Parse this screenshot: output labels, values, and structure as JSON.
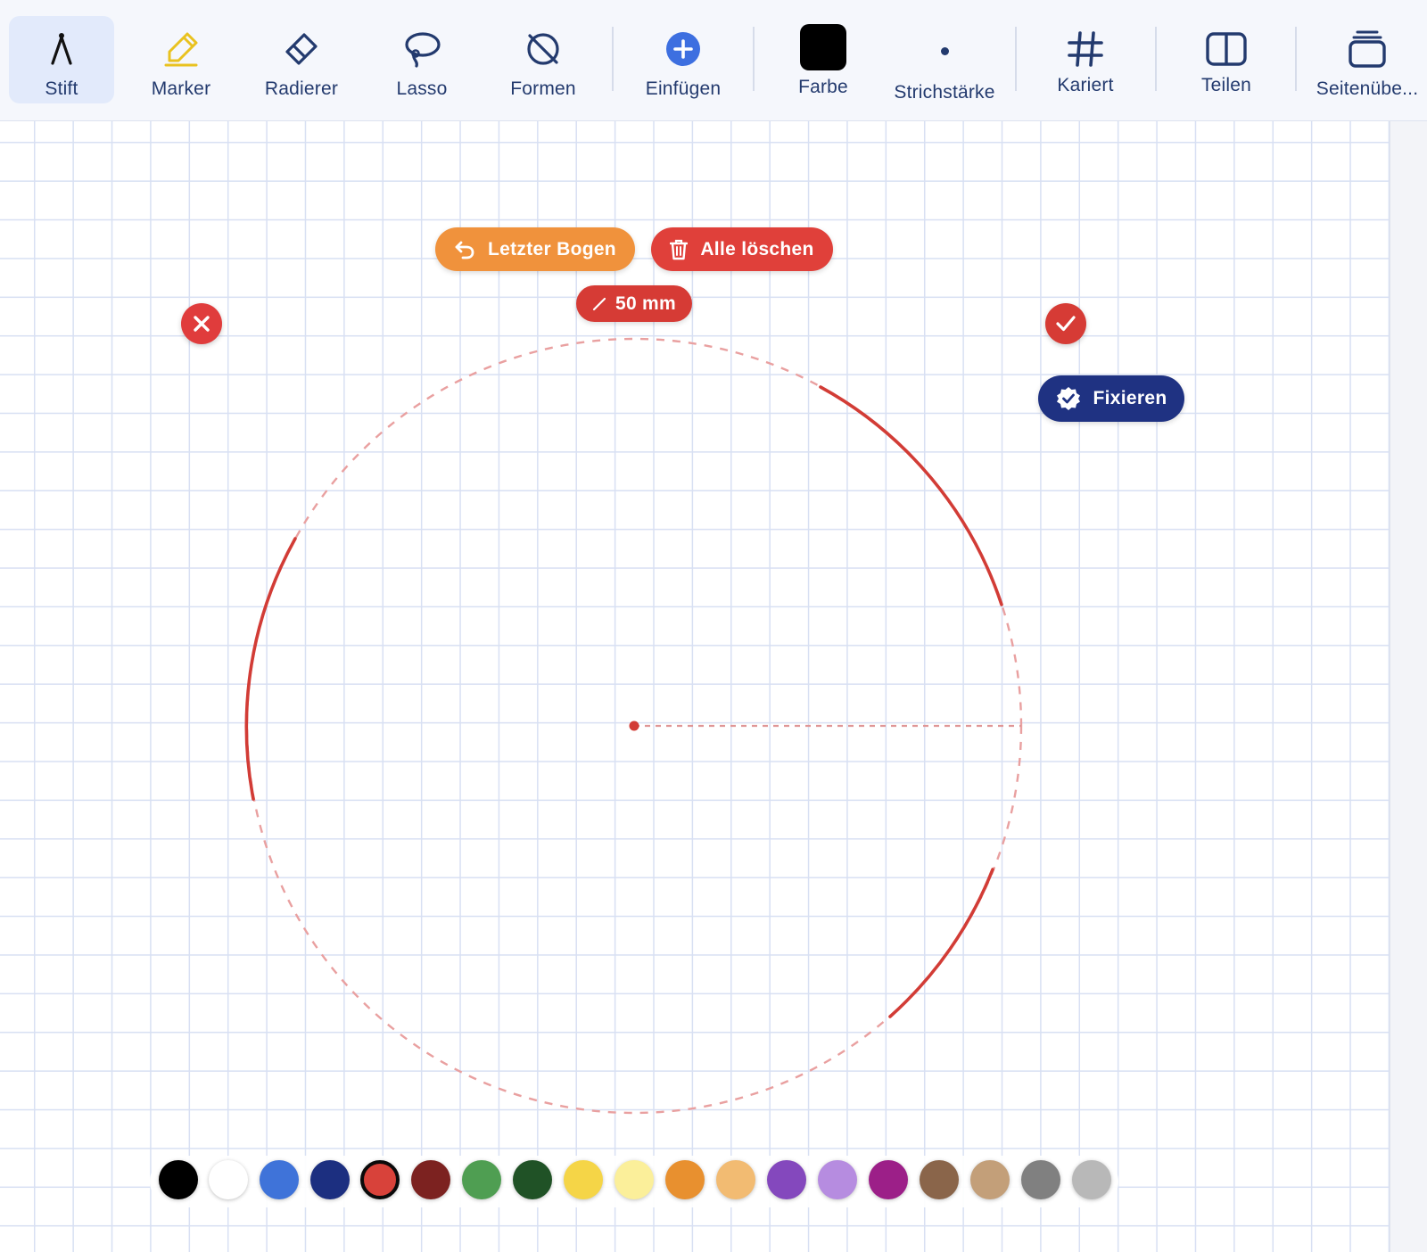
{
  "toolbar": {
    "tools": [
      {
        "id": "stift",
        "label": "Stift",
        "icon": "compass-icon",
        "active": true
      },
      {
        "id": "marker",
        "label": "Marker",
        "icon": "highlighter-icon"
      },
      {
        "id": "radierer",
        "label": "Radierer",
        "icon": "eraser-icon"
      },
      {
        "id": "lasso",
        "label": "Lasso",
        "icon": "lasso-icon"
      },
      {
        "id": "formen",
        "label": "Formen",
        "icon": "shapes-off-icon"
      },
      {
        "id": "einfuegen",
        "label": "Einfügen",
        "icon": "plus-circle-icon"
      },
      {
        "id": "farbe",
        "label": "Farbe",
        "icon": "color-square-icon",
        "color": "#000000"
      },
      {
        "id": "strichstaerke",
        "label": "Strichstärke",
        "icon": "stroke-dot-icon"
      },
      {
        "id": "kariert",
        "label": "Kariert",
        "icon": "grid-hash-icon"
      },
      {
        "id": "teilen",
        "label": "Teilen",
        "icon": "split-view-icon"
      },
      {
        "id": "seitenuebersicht",
        "label": "Seitenübe...",
        "icon": "stacked-pages-icon"
      }
    ]
  },
  "compass": {
    "undo_label": "Letzter Bogen",
    "clear_label": "Alle löschen",
    "radius_label": "50 mm",
    "fix_label": "Fixieren",
    "colors": {
      "undo": "#f0923c",
      "clear": "#e0403a",
      "radius": "#d63b35",
      "cancel": "#e03c3c",
      "confirm": "#d63b35",
      "fix": "#1f3282",
      "arc": "#d23c36",
      "guide": "#e9a0a0"
    }
  },
  "palette": {
    "colors": [
      "#000000",
      "#ffffff",
      "#3f73d9",
      "#1c2f80",
      "#d8423a",
      "#7c2220",
      "#4f9e52",
      "#205226",
      "#f5d547",
      "#fbef9a",
      "#e8902f",
      "#f2bb72",
      "#8448bd",
      "#b68ce0",
      "#9c1f88",
      "#8a654a",
      "#c39f79",
      "#808080",
      "#b8b8b8"
    ],
    "selected_index": 4
  }
}
